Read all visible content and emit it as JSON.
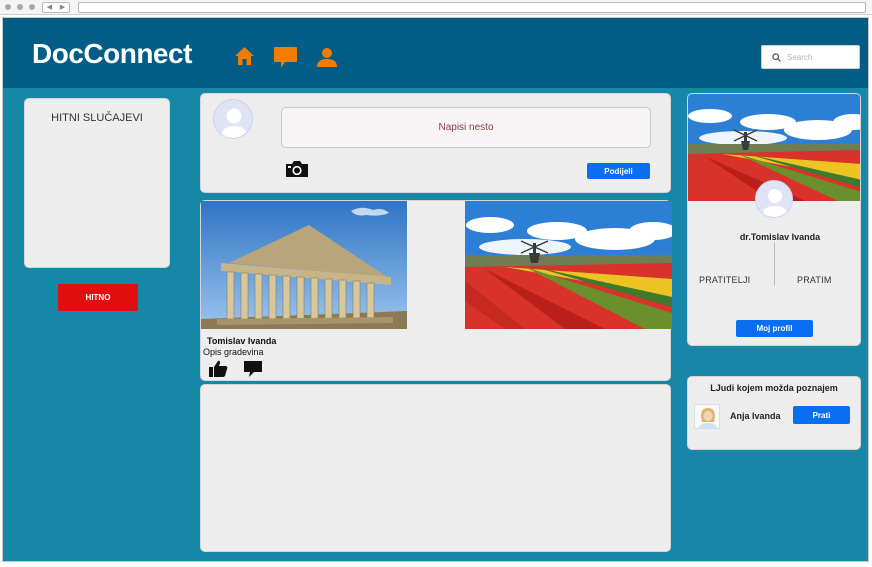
{
  "header": {
    "logo": "DocConnect",
    "search_placeholder": "Search"
  },
  "nav": {
    "icons": [
      "home-icon",
      "chat-icon",
      "user-icon"
    ],
    "accent_color": "#f07d00"
  },
  "colors": {
    "header_bg": "#015c86",
    "page_bg": "#1687a6",
    "card_bg": "#ededed",
    "primary_button": "#0a6ef0",
    "urgent_button": "#e10f0f"
  },
  "left": {
    "urgent_title": "HITNI SLUČAJEVI",
    "urgent_button": "HITNO"
  },
  "composer": {
    "placeholder": "Napisi nesto",
    "share_button": "Podijeli"
  },
  "post": {
    "author": "Tomislav Ivanda",
    "description": "Opis gradevina",
    "images": [
      "parthenon-image",
      "tulip-field-image"
    ]
  },
  "profile": {
    "name": "dr.Tomislav Ivanda",
    "followers_label": "PRATITELJI",
    "following_label": "PRATIM",
    "my_profile_button": "Moj profil"
  },
  "suggestions": {
    "title": "LJudi kojem možda poznajem",
    "people": [
      {
        "name": "Anja Ivanda",
        "follow_button": "Prati"
      }
    ]
  }
}
